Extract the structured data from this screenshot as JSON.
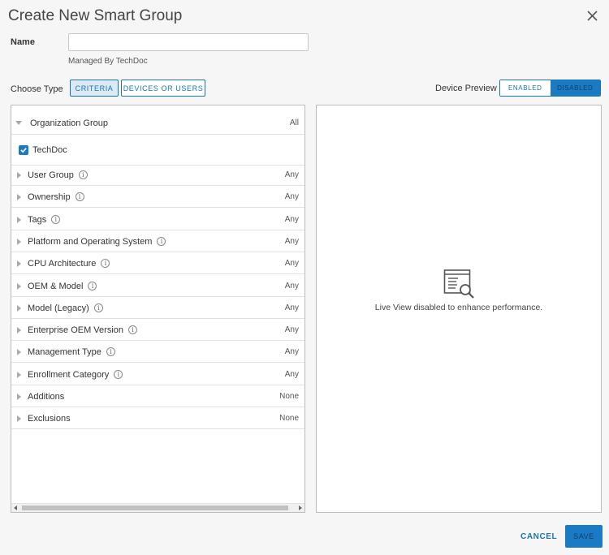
{
  "dialog": {
    "title": "Create New Smart Group"
  },
  "name_field": {
    "label": "Name",
    "value": "",
    "placeholder": "",
    "managed_by": "Managed By TechDoc"
  },
  "choose_type": {
    "label": "Choose Type",
    "criteria_label": "CRITERIA",
    "devices_label": "DEVICES OR USERS"
  },
  "device_preview": {
    "label": "Device Preview",
    "enabled_label": "ENABLED",
    "disabled_label": "DISABLED",
    "selected": "DISABLED"
  },
  "org_group": {
    "label": "Organization Group",
    "value": "All",
    "checked_item": "TechDoc"
  },
  "criteria": [
    {
      "label": "User Group",
      "value": "Any",
      "info": true
    },
    {
      "label": "Ownership",
      "value": "Any",
      "info": true
    },
    {
      "label": "Tags",
      "value": "Any",
      "info": true
    },
    {
      "label": "Platform and Operating System",
      "value": "Any",
      "info": true
    },
    {
      "label": "CPU Architecture",
      "value": "Any",
      "info": true
    },
    {
      "label": "OEM & Model",
      "value": "Any",
      "info": true
    },
    {
      "label": "Model (Legacy)",
      "value": "Any",
      "info": true
    },
    {
      "label": "Enterprise OEM Version",
      "value": "Any",
      "info": true
    },
    {
      "label": "Management Type",
      "value": "Any",
      "info": true
    },
    {
      "label": "Enrollment Category",
      "value": "Any",
      "info": true
    },
    {
      "label": "Additions",
      "value": "None",
      "info": false
    },
    {
      "label": "Exclusions",
      "value": "None",
      "info": false
    }
  ],
  "preview": {
    "message": "Live View disabled to enhance performance.",
    "icon": "list-search-icon"
  },
  "footer": {
    "cancel_label": "CANCEL",
    "save_label": "SAVE"
  },
  "colors": {
    "accent": "#1b7ac4",
    "link": "#1a73b6",
    "background": "#f6f6f6"
  }
}
